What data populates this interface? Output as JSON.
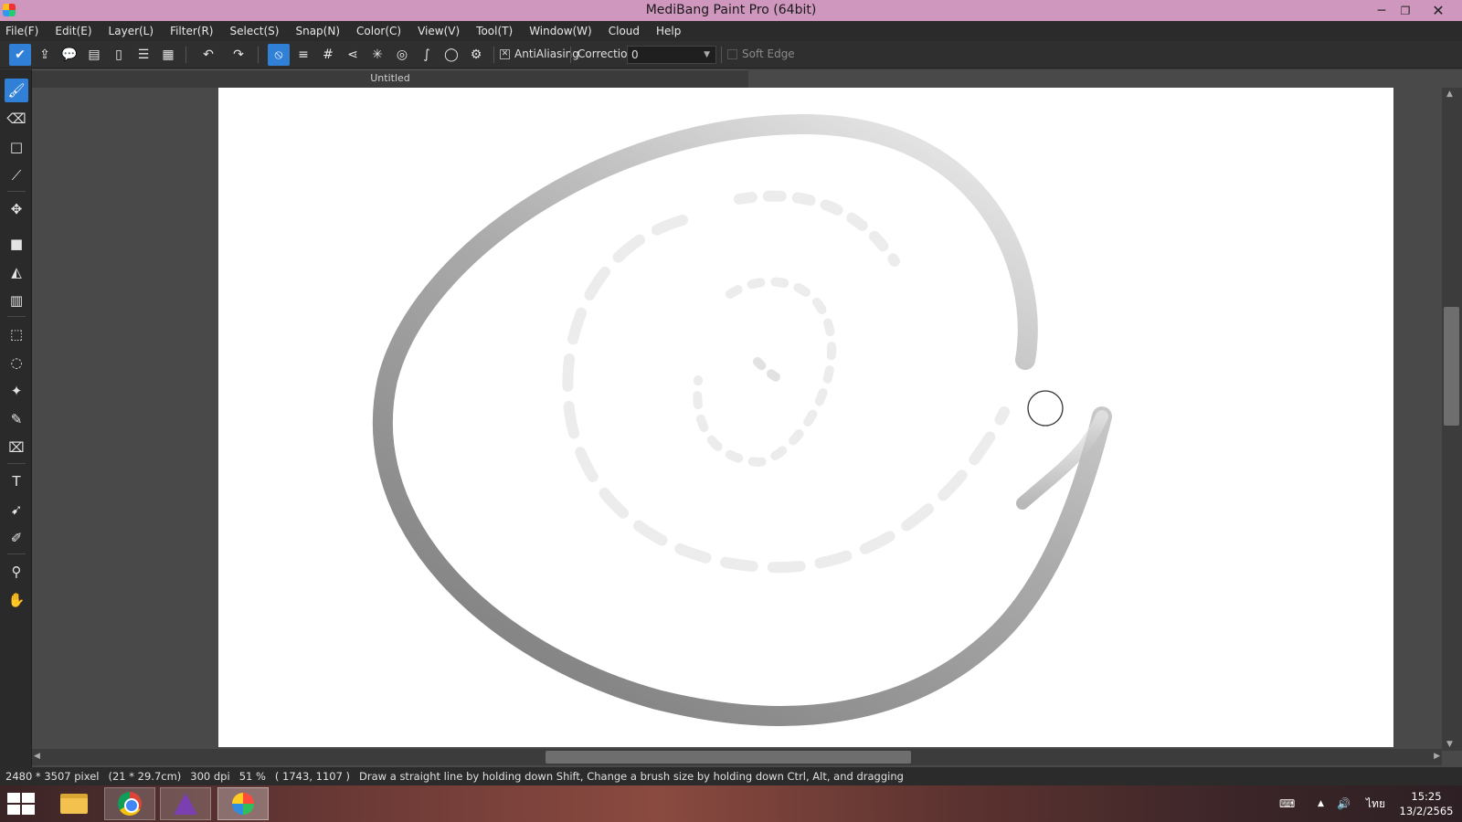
{
  "window": {
    "title": "MediBang Paint Pro (64bit)",
    "minimize": "─",
    "maximize": "❐",
    "close": "✕"
  },
  "menu": [
    "File(F)",
    "Edit(E)",
    "Layer(L)",
    "Filter(R)",
    "Select(S)",
    "Snap(N)",
    "Color(C)",
    "View(V)",
    "Tool(T)",
    "Window(W)",
    "Cloud",
    "Help"
  ],
  "toolbar": {
    "antialiasing_label": "AntiAliasing",
    "antialiasing_checked": "✕",
    "correction_label": "Correction",
    "correction_value": "0",
    "soft_edge_label": "Soft Edge"
  },
  "document": {
    "tab_title": "Untitled"
  },
  "status": {
    "size": "2480 * 3507 pixel",
    "physical": "(21 * 29.7cm)",
    "dpi": "300 dpi",
    "zoom": "51 %",
    "cursor": "( 1743, 1107 )",
    "hint": "Draw a straight line by holding down Shift, Change a brush size by holding down Ctrl, Alt, and dragging"
  },
  "taskbar": {
    "keyboard_icon": "keyboard-icon",
    "language": "ไทย",
    "time": "15:25",
    "date": "13/2/2565"
  },
  "colors": {
    "titlebar": "#cf97bd",
    "accent": "#2f80d6",
    "canvas": "#ffffff",
    "workspace": "#494949"
  }
}
